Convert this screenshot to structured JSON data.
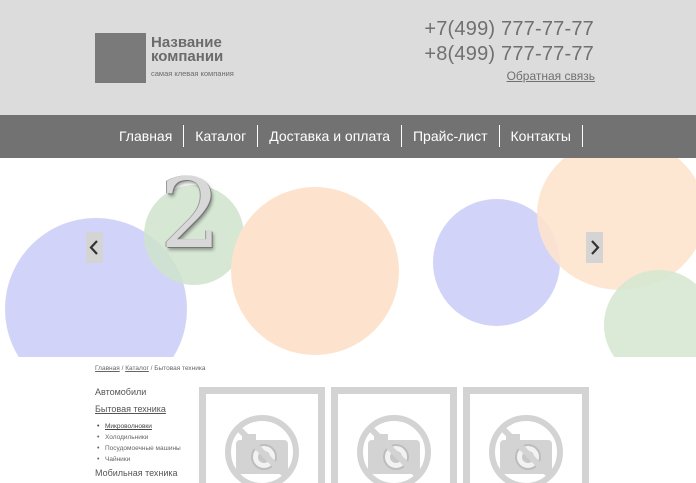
{
  "header": {
    "company_name": "Название компании",
    "tagline": "самая клевая компания",
    "phone_1": "+7(499) 777-77-77",
    "phone_2": "+8(499) 777-77-77",
    "callback_link": "Обратная связь"
  },
  "nav": {
    "items": [
      {
        "label": "Главная"
      },
      {
        "label": "Каталог"
      },
      {
        "label": "Доставка и оплата"
      },
      {
        "label": "Прайс-лист"
      },
      {
        "label": "Контакты"
      }
    ]
  },
  "slider": {
    "current_slide": "2",
    "prev_icon": "chevron-left-icon",
    "next_icon": "chevron-right-icon",
    "colors": {
      "blue": "#c9cdf7",
      "green": "#d6e8d2",
      "peach": "#fde3cd",
      "arrow_bg": "#d4d4d4"
    }
  },
  "breadcrumb": {
    "items": [
      "Главная",
      "Каталог",
      "Бытовая техника"
    ],
    "separator": "/"
  },
  "sidebar": {
    "categories": [
      "Автомобили",
      "Бытовая техника",
      "Мобильная техника"
    ],
    "subcategories": [
      {
        "label": "Микроволновки",
        "active": true
      },
      {
        "label": "Холодильники"
      },
      {
        "label": "Посудомоечные машины"
      },
      {
        "label": "Чайники"
      }
    ]
  },
  "products": {
    "placeholder_icon": "no-photo-camera-icon",
    "count": 3
  },
  "colors": {
    "header_bg": "#dcdcdc",
    "nav_bg": "#727272",
    "logo": "#7a7a7a",
    "card_border": "#d3d3d3"
  }
}
